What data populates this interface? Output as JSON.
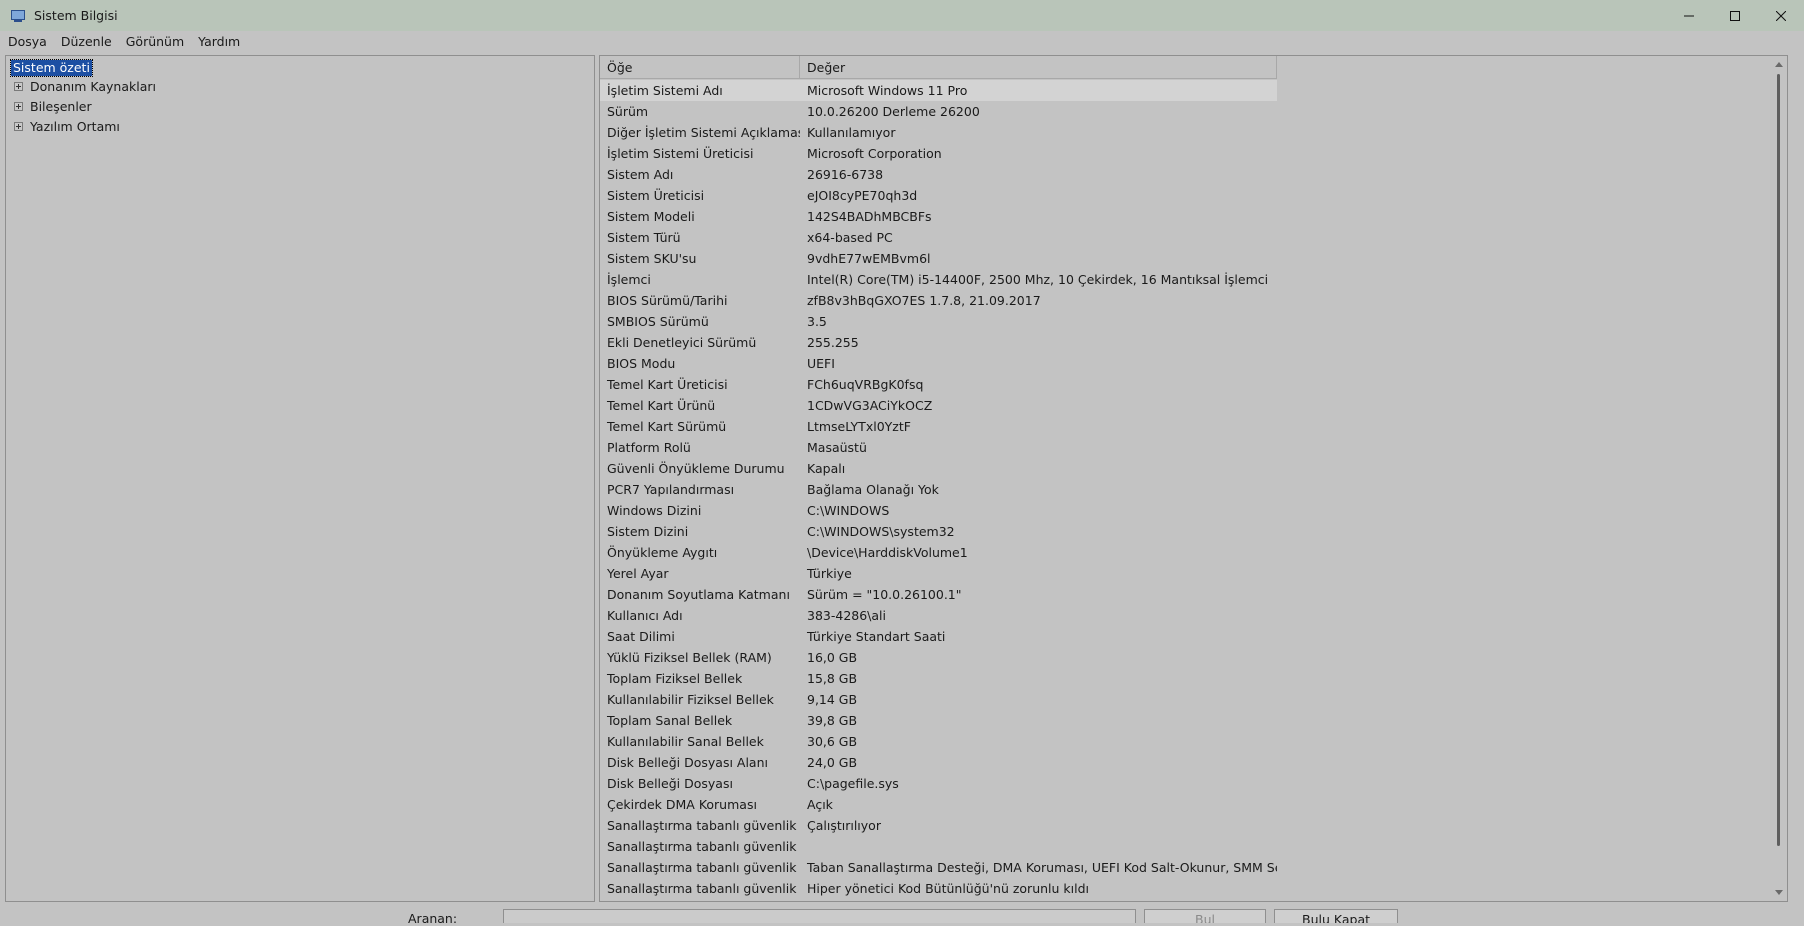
{
  "window": {
    "title": "Sistem Bilgisi"
  },
  "menu": [
    "Dosya",
    "Düzenle",
    "Görünüm",
    "Yardım"
  ],
  "tree": {
    "root": "Sistem özeti",
    "children": [
      "Donanım Kaynakları",
      "Bileşenler",
      "Yazılım Ortamı"
    ]
  },
  "list": {
    "columns": [
      "Öğe",
      "Değer"
    ],
    "rows": [
      [
        "İşletim Sistemi Adı",
        "Microsoft Windows 11 Pro"
      ],
      [
        "Sürüm",
        "10.0.26200 Derleme 26200"
      ],
      [
        "Diğer İşletim Sistemi Açıklaması",
        "Kullanılamıyor"
      ],
      [
        "İşletim Sistemi Üreticisi",
        "Microsoft Corporation"
      ],
      [
        "Sistem Adı",
        "26916-6738"
      ],
      [
        "Sistem Üreticisi",
        "eJOI8cyPE70qh3d"
      ],
      [
        "Sistem Modeli",
        "142S4BADhMBCBFs"
      ],
      [
        "Sistem Türü",
        "x64-based PC"
      ],
      [
        "Sistem SKU'su",
        "9vdhE77wEMBvm6l"
      ],
      [
        "İşlemci",
        "Intel(R) Core(TM) i5-14400F, 2500 Mhz, 10 Çekirdek, 16 Mantıksal İşlemci"
      ],
      [
        "BIOS Sürümü/Tarihi",
        "zfB8v3hBqGXO7ES 1.7.8, 21.09.2017"
      ],
      [
        "SMBIOS Sürümü",
        "3.5"
      ],
      [
        "Ekli Denetleyici Sürümü",
        "255.255"
      ],
      [
        "BIOS Modu",
        "UEFI"
      ],
      [
        "Temel Kart Üreticisi",
        "FCh6uqVRBgK0fsq"
      ],
      [
        "Temel Kart Ürünü",
        "1CDwVG3ACiYkOCZ"
      ],
      [
        "Temel Kart Sürümü",
        "LtmseLYTxl0YztF"
      ],
      [
        "Platform Rolü",
        "Masaüstü"
      ],
      [
        "Güvenli Önyükleme Durumu",
        "Kapalı"
      ],
      [
        "PCR7 Yapılandırması",
        "Bağlama Olanağı Yok"
      ],
      [
        "Windows Dizini",
        "C:\\WINDOWS"
      ],
      [
        "Sistem Dizini",
        "C:\\WINDOWS\\system32"
      ],
      [
        "Önyükleme Aygıtı",
        "\\Device\\HarddiskVolume1"
      ],
      [
        "Yerel Ayar",
        "Türkiye"
      ],
      [
        "Donanım Soyutlama Katmanı",
        "Sürüm = \"10.0.26100.1\""
      ],
      [
        "Kullanıcı Adı",
        "383-4286\\ali"
      ],
      [
        "Saat Dilimi",
        "Türkiye Standart Saati"
      ],
      [
        "Yüklü Fiziksel Bellek (RAM)",
        "16,0 GB"
      ],
      [
        "Toplam Fiziksel Bellek",
        "15,8 GB"
      ],
      [
        "Kullanılabilir Fiziksel Bellek",
        "9,14 GB"
      ],
      [
        "Toplam Sanal Bellek",
        "39,8 GB"
      ],
      [
        "Kullanılabilir Sanal Bellek",
        "30,6 GB"
      ],
      [
        "Disk Belleği Dosyası Alanı",
        "24,0 GB"
      ],
      [
        "Disk Belleği Dosyası",
        "C:\\pagefile.sys"
      ],
      [
        "Çekirdek DMA Koruması",
        "Açık"
      ],
      [
        "Sanallaştırma tabanlı güvenlik",
        "Çalıştırılıyor"
      ],
      [
        "Sanallaştırma tabanlı güvenlik ...",
        ""
      ],
      [
        "Sanallaştırma tabanlı güvenlik K...",
        "Taban Sanallaştırma Desteği, DMA Koruması, UEFI Kod Salt-Okunur, SMM Sec..."
      ],
      [
        "Sanallaştırma tabanlı güvenlik Y...",
        "Hiper yönetici Kod Bütünlüğü'nü zorunlu kıldı"
      ]
    ]
  },
  "search": {
    "label": "Aranan:",
    "value": "",
    "find_label": "Bul",
    "close_find_label": "Bulu Kapat"
  }
}
